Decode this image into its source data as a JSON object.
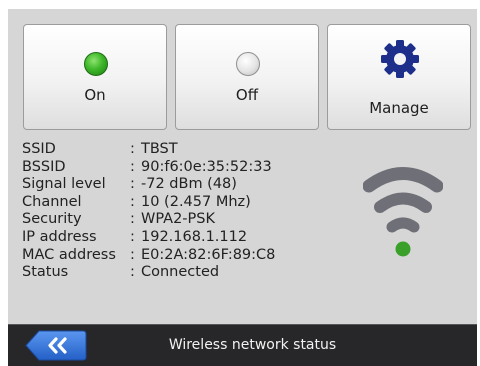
{
  "buttons": {
    "on_label": "On",
    "off_label": "Off",
    "manage_label": "Manage"
  },
  "info": [
    {
      "key": "SSID",
      "value": "TBST"
    },
    {
      "key": "BSSID",
      "value": "90:f6:0e:35:52:33"
    },
    {
      "key": "Signal level",
      "value": "-72 dBm (48)"
    },
    {
      "key": "Channel",
      "value": "10 (2.457 Mhz)"
    },
    {
      "key": "Security",
      "value": "WPA2-PSK"
    },
    {
      "key": "IP address",
      "value": "192.168.1.112"
    },
    {
      "key": "MAC address",
      "value": "E0:2A:82:6F:89:C8"
    },
    {
      "key": "Status",
      "value": "Connected"
    }
  ],
  "separator": ":",
  "icons": {
    "on_led": "green-led-icon",
    "off_led": "grey-led-icon",
    "manage": "gear-icon",
    "signal": "wifi-signal-icon",
    "back": "double-chevron-left-icon"
  },
  "colors": {
    "background": "#d6d6d6",
    "led_on": "#3fb82a",
    "gear": "#1d2f8a",
    "wifi_bars": "#6f6f78",
    "wifi_dot": "#3aa02a",
    "bottom_bar": "#27272a",
    "back_button": "#2f6fd6"
  },
  "bottom_bar": {
    "title": "Wireless network status"
  }
}
